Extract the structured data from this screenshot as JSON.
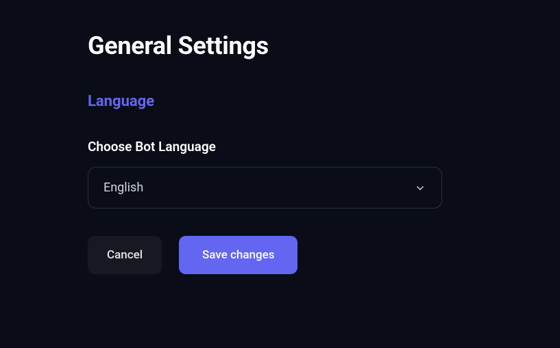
{
  "page": {
    "title": "General Settings"
  },
  "section": {
    "heading": "Language"
  },
  "language": {
    "label": "Choose Bot Language",
    "selected": "English"
  },
  "actions": {
    "cancel": "Cancel",
    "save": "Save changes"
  },
  "colors": {
    "accent": "#6366f1",
    "background": "#0a0d17"
  }
}
